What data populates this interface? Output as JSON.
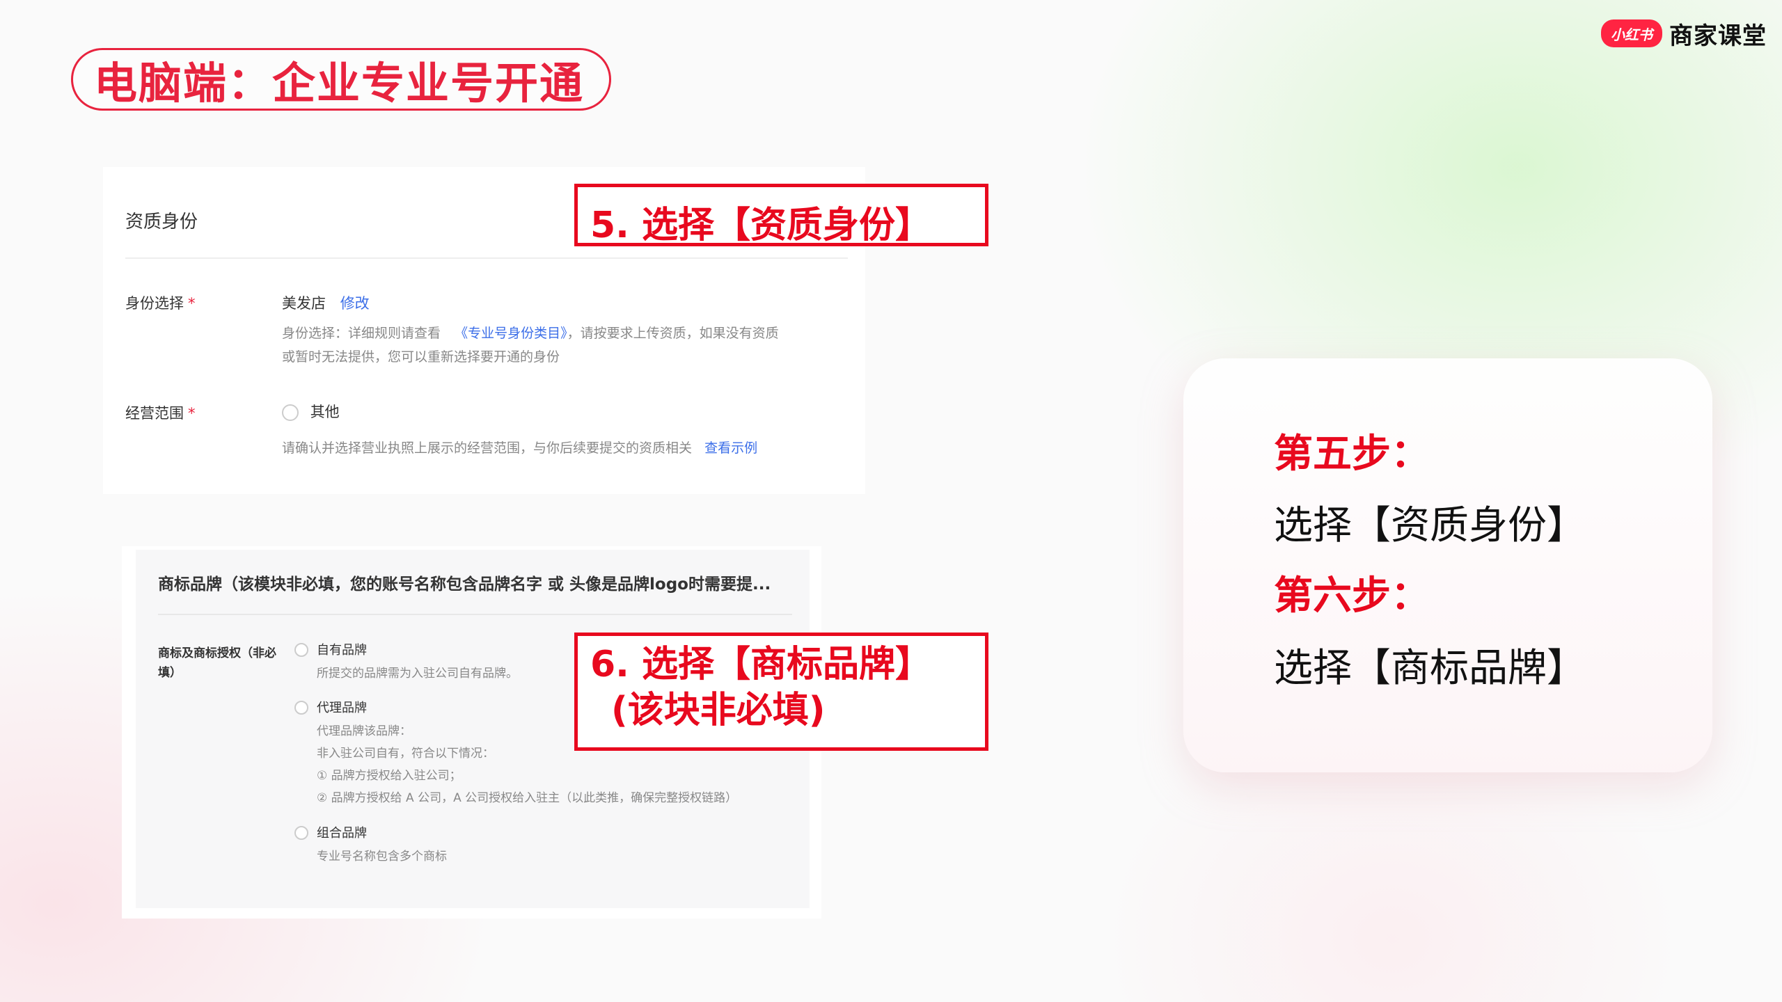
{
  "title": "电脑端：企业专业号开通",
  "logo": {
    "badge": "小红书",
    "text": "商家课堂"
  },
  "card1": {
    "section_title": "资质身份",
    "identity_label": "身份选择",
    "required_mark": "*",
    "identity_value": "美发店",
    "edit_link": "修改",
    "identity_hint_prefix": "身份选择：详细规则请查看",
    "identity_hint_link": "《专业号身份类目》",
    "identity_hint_suffix": "，请按要求上传资质，如果没有资质",
    "identity_hint_line2": "或暂时无法提供，您可以重新选择要开通的身份",
    "scope_label": "经营范围",
    "scope_option": "其他",
    "scope_hint": "请确认并选择营业执照上展示的经营范围，与你后续要提交的资质相关",
    "scope_hint_link": "查看示例"
  },
  "card2": {
    "section_title": "商标品牌（该模块非必填，您的账号名称包含品牌名字 或 头像是品牌logo时需要提...",
    "label_line1": "商标及商标授权（非必",
    "label_line2": "填）",
    "options": [
      {
        "name": "自有品牌",
        "desc": [
          "所提交的品牌需为入驻公司自有品牌。"
        ]
      },
      {
        "name": "代理品牌",
        "desc": [
          "代理品牌该品牌：",
          "非入驻公司自有，符合以下情况：",
          "① 品牌方授权给入驻公司；",
          "② 品牌方授权给 A 公司，A 公司授权给入驻主（以此类推，确保完整授权链路）"
        ]
      },
      {
        "name": "组合品牌",
        "desc": [
          "专业号名称包含多个商标"
        ]
      }
    ]
  },
  "annotations": {
    "step5": "5. 选择【资质身份】",
    "step6_line1": "6. 选择【商标品牌】",
    "step6_line2": "(该块非必填)"
  },
  "summary": {
    "step5_title": "第五步：",
    "step5_action": "选择【资质身份】",
    "step6_title": "第六步：",
    "step6_action": "选择【商标品牌】"
  },
  "colors": {
    "brand_red": "#e8233e",
    "annotation_red": "#e8091e",
    "link_blue": "#3b6ee8"
  }
}
